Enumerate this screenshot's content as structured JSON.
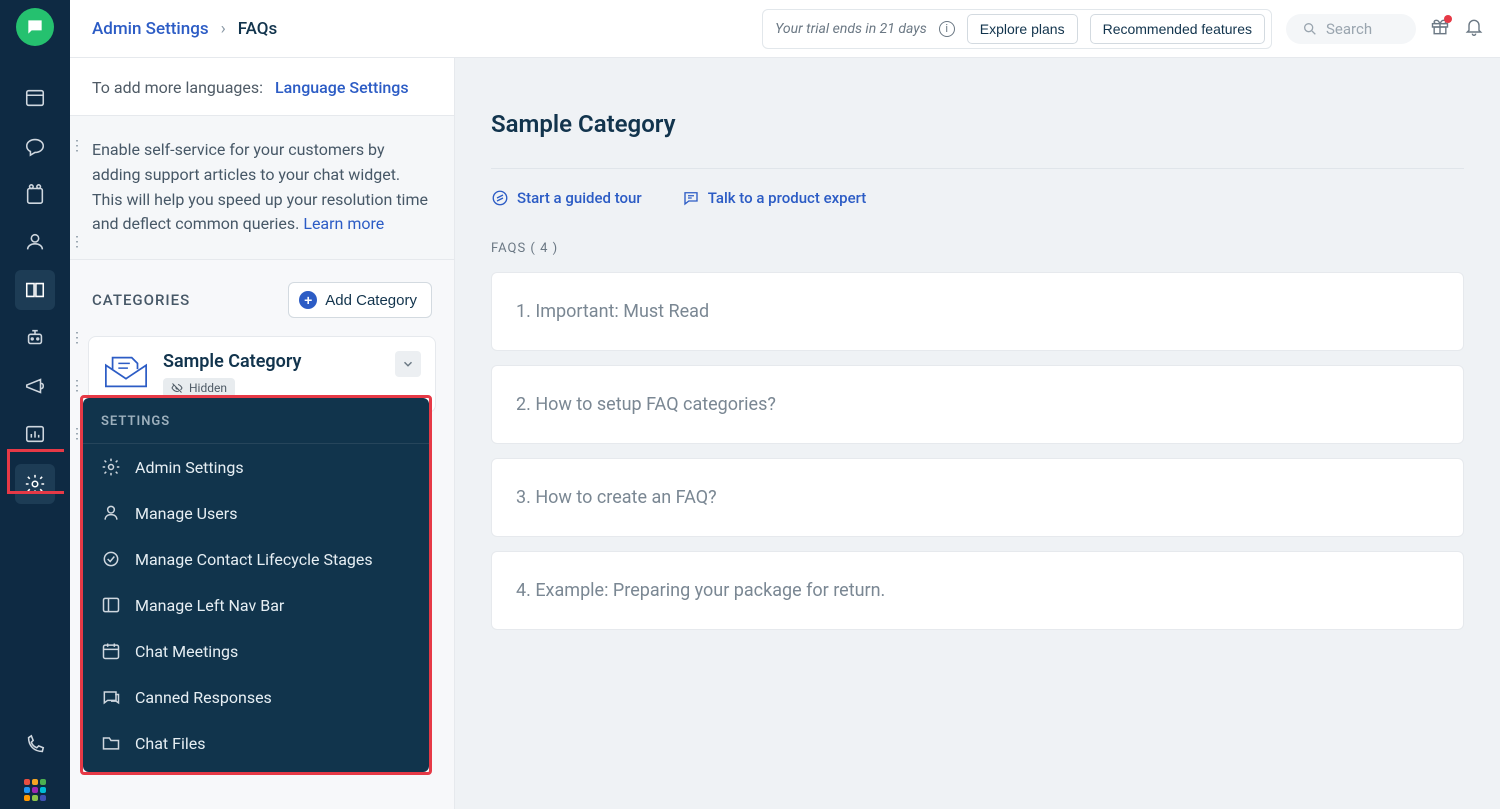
{
  "breadcrumb": {
    "parent": "Admin Settings",
    "current": "FAQs"
  },
  "trial": {
    "msg": "Your trial ends in 21 days",
    "explore": "Explore plans",
    "recommended": "Recommended features"
  },
  "search": {
    "placeholder": "Search"
  },
  "sub": {
    "lang_label": "To add more languages:",
    "lang_link": "Language Settings",
    "help": "Enable self-service for your customers by adding support articles to your chat widget. This will help you speed up your resolution time and deflect common queries. ",
    "learn_more": "Learn more",
    "categories_label": "CATEGORIES",
    "add_label": "Add Category",
    "card": {
      "title": "Sample Category",
      "badge": "Hidden"
    }
  },
  "settings_menu": {
    "header": "SETTINGS",
    "items": [
      {
        "label": "Admin Settings",
        "icon": "gear"
      },
      {
        "label": "Manage Users",
        "icon": "user"
      },
      {
        "label": "Manage Contact Lifecycle Stages",
        "icon": "cycle"
      },
      {
        "label": "Manage Left Nav Bar",
        "icon": "layout"
      },
      {
        "label": "Chat Meetings",
        "icon": "calendar"
      },
      {
        "label": "Canned Responses",
        "icon": "canned"
      },
      {
        "label": "Chat Files",
        "icon": "folder"
      }
    ]
  },
  "main": {
    "title": "Sample Category",
    "tour": "Start a guided tour",
    "expert": "Talk to a product expert",
    "faq_count_label": "FAQS ( 4 )",
    "faqs": [
      "1. Important: Must Read",
      "2. How to setup FAQ categories?",
      "3. How to create an FAQ?",
      "4. Example: Preparing your package for return."
    ]
  }
}
